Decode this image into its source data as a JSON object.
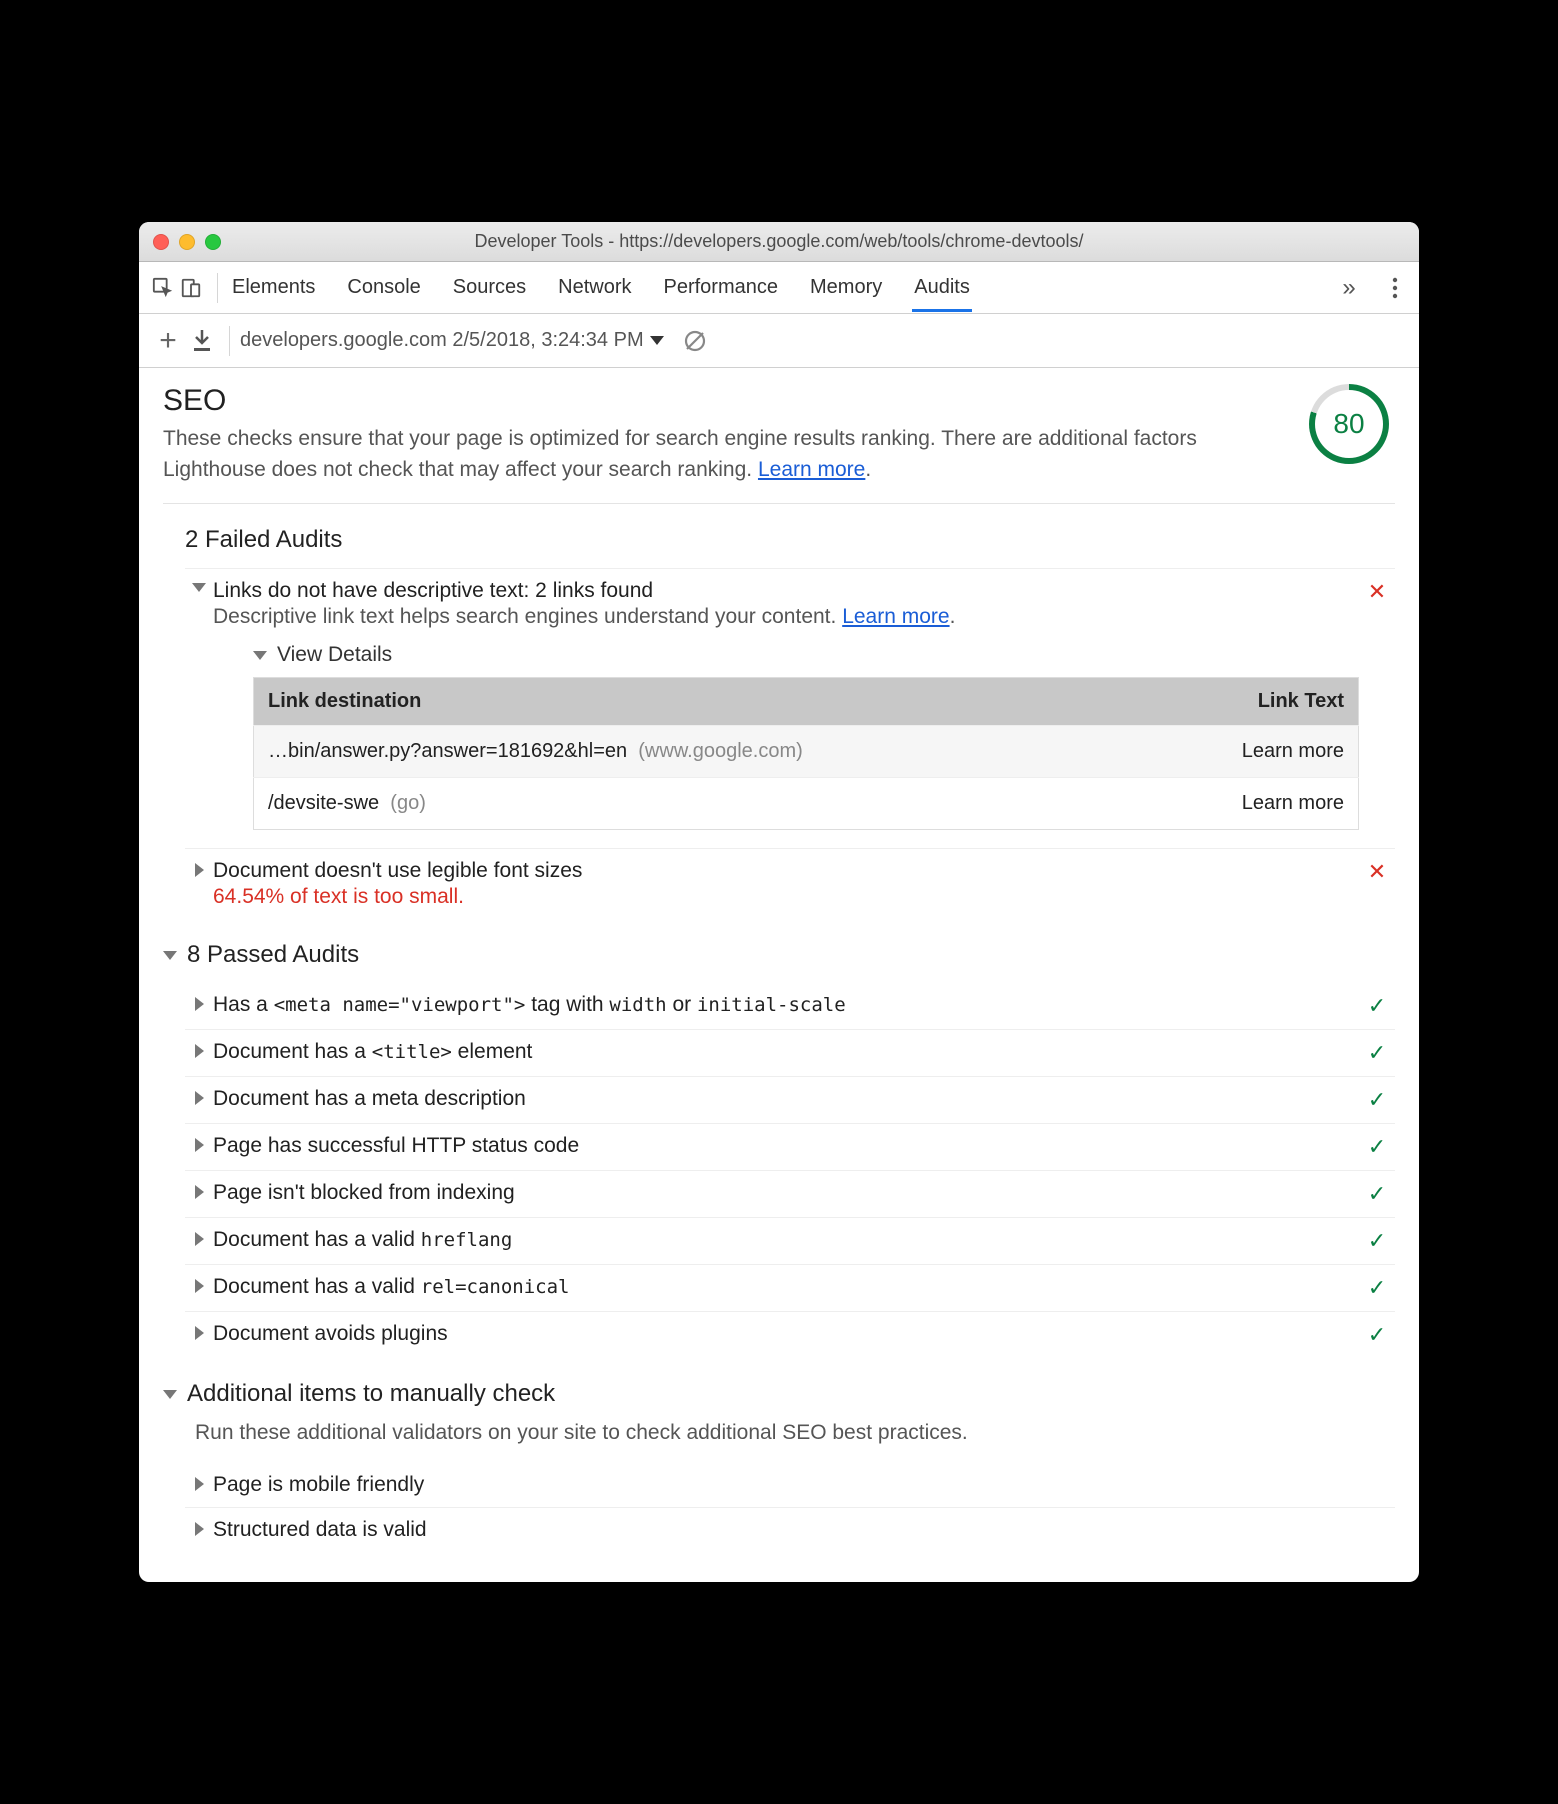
{
  "window_title": "Developer Tools - https://developers.google.com/web/tools/chrome-devtools/",
  "tabs": [
    "Elements",
    "Console",
    "Sources",
    "Network",
    "Performance",
    "Memory",
    "Audits"
  ],
  "active_tab": "Audits",
  "run_label": "developers.google.com 2/5/2018, 3:24:34 PM",
  "seo": {
    "title": "SEO",
    "desc_a": "These checks ensure that your page is optimized for search engine results ranking. There are additional factors Lighthouse does not check that may affect your search ranking. ",
    "learn_more": "Learn more",
    "score": "80"
  },
  "failed": {
    "heading": "2 Failed Audits",
    "items": [
      {
        "title": "Links do not have descriptive text: 2 links found",
        "sub_a": "Descriptive link text helps search engines understand your content. ",
        "learn_more": "Learn more",
        "expanded": true,
        "details_label": "View Details",
        "table": {
          "col1": "Link destination",
          "col2": "Link Text",
          "rows": [
            {
              "dest": "…bin/answer.py?answer=181692&hl=en",
              "host": "(www.google.com)",
              "text": "Learn more"
            },
            {
              "dest": "/devsite-swe",
              "host": "(go)",
              "text": "Learn more"
            }
          ]
        }
      },
      {
        "title": "Document doesn't use legible font sizes",
        "warn": "64.54% of text is too small.",
        "expanded": false
      }
    ]
  },
  "passed": {
    "heading": "8 Passed Audits",
    "items": [
      {
        "html": "Has a <code>&lt;meta name=\"viewport\"&gt;</code> tag with <code>width</code> or <code>initial-scale</code>"
      },
      {
        "html": "Document has a <code>&lt;title&gt;</code> element"
      },
      {
        "html": "Document has a meta description"
      },
      {
        "html": "Page has successful HTTP status code"
      },
      {
        "html": "Page isn't blocked from indexing"
      },
      {
        "html": "Document has a valid <code>hreflang</code>"
      },
      {
        "html": "Document has a valid <code>rel=canonical</code>"
      },
      {
        "html": "Document avoids plugins"
      }
    ]
  },
  "manual": {
    "heading": "Additional items to manually check",
    "sub": "Run these additional validators on your site to check additional SEO best practices.",
    "items": [
      {
        "title": "Page is mobile friendly"
      },
      {
        "title": "Structured data is valid"
      }
    ]
  }
}
